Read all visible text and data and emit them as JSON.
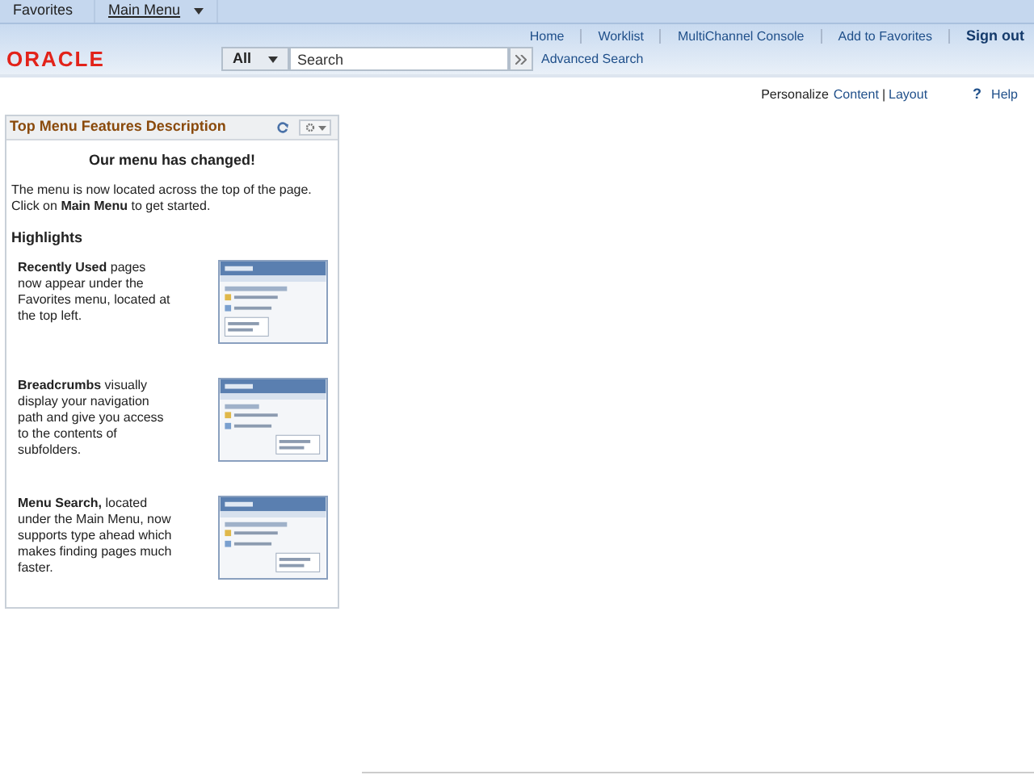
{
  "menu_bar": [
    {
      "label": "Favorites",
      "underlined": false
    },
    {
      "label": "Main Menu",
      "underlined": true
    }
  ],
  "logo": "ORACLE",
  "search": {
    "scope": "All",
    "placeholder": "Search",
    "advanced": "Advanced Search"
  },
  "nav_links": [
    {
      "label": "Home",
      "bold": false
    },
    {
      "label": "Worklist",
      "bold": false
    },
    {
      "label": "MultiChannel Console",
      "bold": false
    },
    {
      "label": "Add to Favorites",
      "bold": false
    },
    {
      "label": "Sign out",
      "bold": true
    }
  ],
  "personalize": {
    "label": "Personalize",
    "content": "Content",
    "separator": "|",
    "layout": "Layout",
    "help_icon": "?",
    "help": "Help"
  },
  "panel": {
    "title": "Top Menu Features Description",
    "heading": "Our menu has changed!",
    "intro": "The menu is now located across the top of the page. Click on **Main Menu** to get started.",
    "subheading": "Highlights",
    "highlights": [
      {
        "text": "**Recently Used** pages now appear under the Favorites menu, located at the top left."
      },
      {
        "text": "**Breadcrumbs** visually display your navigation path and give you access to the contents of subfolders."
      },
      {
        "text": "**Menu Search,** located under the Main Menu, now supports type ahead which makes finding pages much faster."
      }
    ]
  }
}
